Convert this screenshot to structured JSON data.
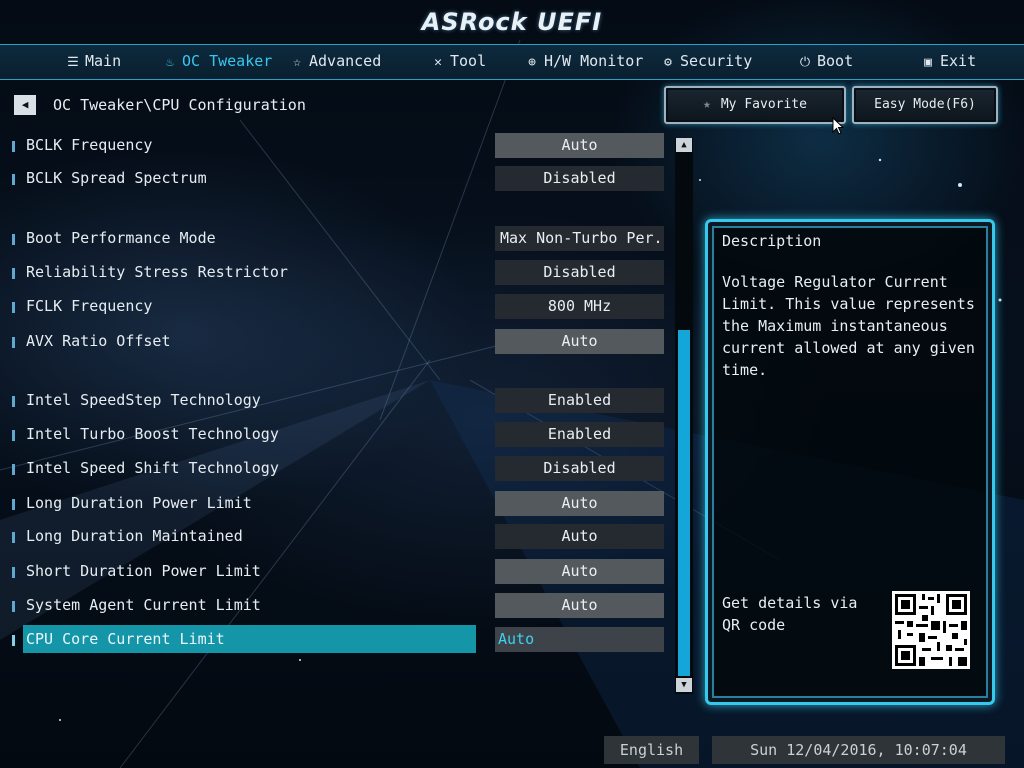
{
  "app": {
    "logo": "ASRock UEFI"
  },
  "nav": {
    "tabs": [
      {
        "label": "Main",
        "icon": "list-icon"
      },
      {
        "label": "OC Tweaker",
        "icon": "flame-icon",
        "active": true
      },
      {
        "label": "Advanced",
        "icon": "star-icon"
      },
      {
        "label": "Tool",
        "icon": "tools-icon"
      },
      {
        "label": "H/W Monitor",
        "icon": "monitor-icon"
      },
      {
        "label": "Security",
        "icon": "shield-icon"
      },
      {
        "label": "Boot",
        "icon": "power-icon"
      },
      {
        "label": "Exit",
        "icon": "exit-icon"
      }
    ]
  },
  "breadcrumb": {
    "path": "OC Tweaker\\CPU Configuration"
  },
  "buttons": {
    "favorite": "My Favorite",
    "easy_mode": "Easy Mode(F6)"
  },
  "settings": [
    {
      "label": "BCLK Frequency",
      "value": "Auto"
    },
    {
      "label": "BCLK Spread Spectrum",
      "value": "Disabled"
    },
    {
      "label": "Boot Performance Mode",
      "value": "Max Non-Turbo Per..."
    },
    {
      "label": "Reliability Stress Restrictor",
      "value": "Disabled"
    },
    {
      "label": "FCLK Frequency",
      "value": "800 MHz"
    },
    {
      "label": "AVX Ratio Offset",
      "value": "Auto"
    },
    {
      "label": "Intel SpeedStep Technology",
      "value": "Enabled"
    },
    {
      "label": "Intel Turbo Boost Technology",
      "value": "Enabled"
    },
    {
      "label": "Intel Speed Shift Technology",
      "value": "Disabled"
    },
    {
      "label": "Long Duration Power Limit",
      "value": "Auto"
    },
    {
      "label": "Long Duration Maintained",
      "value": "Auto"
    },
    {
      "label": "Short Duration Power Limit",
      "value": "Auto"
    },
    {
      "label": "System Agent Current Limit",
      "value": "Auto"
    },
    {
      "label": "CPU Core Current Limit",
      "value": "Auto",
      "selected": true
    }
  ],
  "description": {
    "title": "Description",
    "text": "Voltage Regulator Current Limit. This value represents the Maximum instantaneous current allowed at any given time.",
    "qr_text": "Get details via QR code"
  },
  "footer": {
    "language": "English",
    "datetime": "Sun 12/04/2016, 10:07:04"
  },
  "colors": {
    "accent": "#35c8ee",
    "selected_row": "#1595a8",
    "scroll_thumb": "#14a6d8"
  }
}
